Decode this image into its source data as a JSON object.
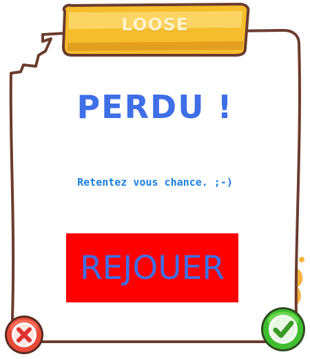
{
  "dialog": {
    "banner_title": "LOOSE",
    "headline": "PERDU !",
    "message": "Retentez vous chance. ;-)",
    "replay_label": "REJOUER"
  },
  "buttons": {
    "cancel_icon": "close-icon",
    "confirm_icon": "checkmark-icon"
  },
  "colors": {
    "headline": "#3f6fe6",
    "message": "#1b7fe0",
    "replay_background": "#ff0000",
    "replay_text": "#3f6fe6",
    "banner": "#f7c530",
    "cancel": "#e03030",
    "confirm": "#3fbf2f"
  }
}
